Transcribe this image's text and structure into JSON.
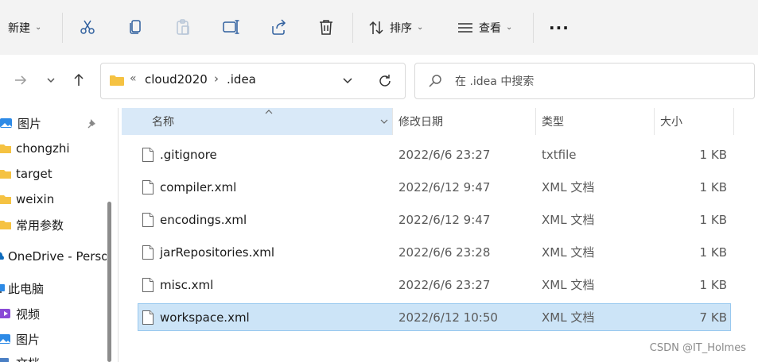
{
  "toolbar": {
    "new_label": "新建",
    "sort_label": "排序",
    "view_label": "查看",
    "more_label": "···"
  },
  "address": {
    "overflow": "«",
    "crumbs": [
      "cloud2020",
      ".idea"
    ],
    "separator": "›"
  },
  "search": {
    "placeholder": "在 .idea 中搜索"
  },
  "sidebar": {
    "items": [
      {
        "label": "图片",
        "icon": "pictures-icon",
        "pinned": true
      },
      {
        "label": "chongzhi",
        "icon": "folder-icon"
      },
      {
        "label": "target",
        "icon": "folder-icon"
      },
      {
        "label": "weixin",
        "icon": "folder-icon"
      },
      {
        "label": "常用参数",
        "icon": "folder-icon"
      },
      {
        "label": "OneDrive - Personal",
        "icon": "cloud-icon"
      },
      {
        "label": "此电脑",
        "icon": "computer-icon"
      },
      {
        "label": "视频",
        "icon": "videos-icon"
      },
      {
        "label": "图片",
        "icon": "pictures-icon"
      },
      {
        "label": "文档",
        "icon": "documents-icon"
      }
    ]
  },
  "columns": {
    "name": "名称",
    "date": "修改日期",
    "type": "类型",
    "size": "大小"
  },
  "files": [
    {
      "name": ".gitignore",
      "date": "2022/6/6 23:27",
      "type": "txtfile",
      "size": "1 KB"
    },
    {
      "name": "compiler.xml",
      "date": "2022/6/12 9:47",
      "type": "XML 文档",
      "size": "1 KB"
    },
    {
      "name": "encodings.xml",
      "date": "2022/6/12 9:47",
      "type": "XML 文档",
      "size": "1 KB"
    },
    {
      "name": "jarRepositories.xml",
      "date": "2022/6/6 23:28",
      "type": "XML 文档",
      "size": "1 KB"
    },
    {
      "name": "misc.xml",
      "date": "2022/6/6 23:27",
      "type": "XML 文档",
      "size": "1 KB"
    },
    {
      "name": "workspace.xml",
      "date": "2022/6/12 10:50",
      "type": "XML 文档",
      "size": "7 KB",
      "selected": true
    }
  ],
  "watermark": "CSDN @IT_Holmes",
  "colors": {
    "accent": "#0067c0",
    "selected_row": "#cce4f7",
    "folder": "#f5c242"
  }
}
